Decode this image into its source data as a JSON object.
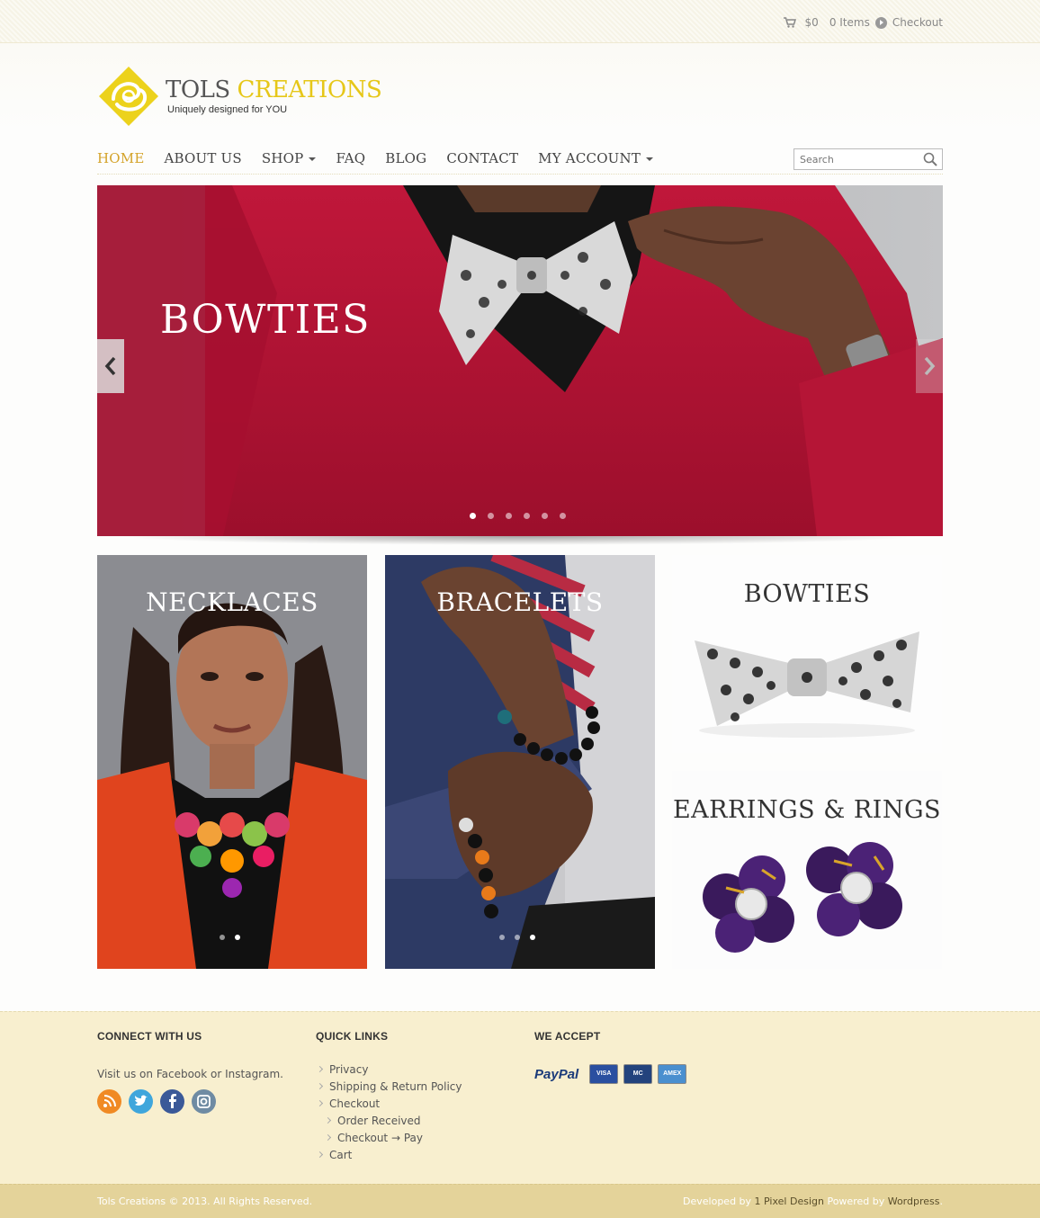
{
  "topbar": {
    "cart_total": "$0",
    "cart_items": "0 Items",
    "checkout": "Checkout"
  },
  "logo": {
    "name_part1": "TOLS ",
    "name_part2": "CREATIONS",
    "tagline": "Uniquely designed for YOU",
    "accent": "#e6c718"
  },
  "nav": {
    "items": [
      {
        "label": "HOME",
        "active": true
      },
      {
        "label": "ABOUT US"
      },
      {
        "label": "SHOP",
        "dropdown": true
      },
      {
        "label": "FAQ"
      },
      {
        "label": "BLOG"
      },
      {
        "label": "CONTACT"
      },
      {
        "label": "MY ACCOUNT",
        "dropdown": true
      }
    ],
    "search_placeholder": "Search"
  },
  "slider": {
    "title": "BOWTIES",
    "slide_count": 6,
    "active_slide": 1
  },
  "tiles": {
    "necklaces": {
      "title": "NECKLACES",
      "dot_count": 2,
      "active": 2
    },
    "bracelets": {
      "title": "BRACELETS",
      "dot_count": 3,
      "active": 3
    },
    "bowties": {
      "title": "BOWTIES"
    },
    "earrings": {
      "title": "EARRINGS & RINGS"
    }
  },
  "footer": {
    "connect": {
      "heading": "CONNECT WITH US",
      "text": "Visit us on Facebook or Instagram.",
      "icons": [
        "rss-icon",
        "twitter-icon",
        "facebook-icon",
        "instagram-icon"
      ]
    },
    "quick_links": {
      "heading": "QUICK LINKS",
      "links": [
        "Privacy",
        "Shipping & Return Policy",
        "Checkout",
        "Order Received",
        "Checkout → Pay",
        "Cart"
      ]
    },
    "accept": {
      "heading": "WE ACCEPT",
      "paypal": "PayPal",
      "cards": [
        "VISA",
        "MC",
        "AMEX"
      ]
    }
  },
  "bottom": {
    "copyright": "Tols Creations © 2013. All Rights Reserved.",
    "developed_by": "Developed by ",
    "developer": "1 Pixel Design",
    "powered_by": " Powered by ",
    "platform": "Wordpress",
    "end": "."
  }
}
